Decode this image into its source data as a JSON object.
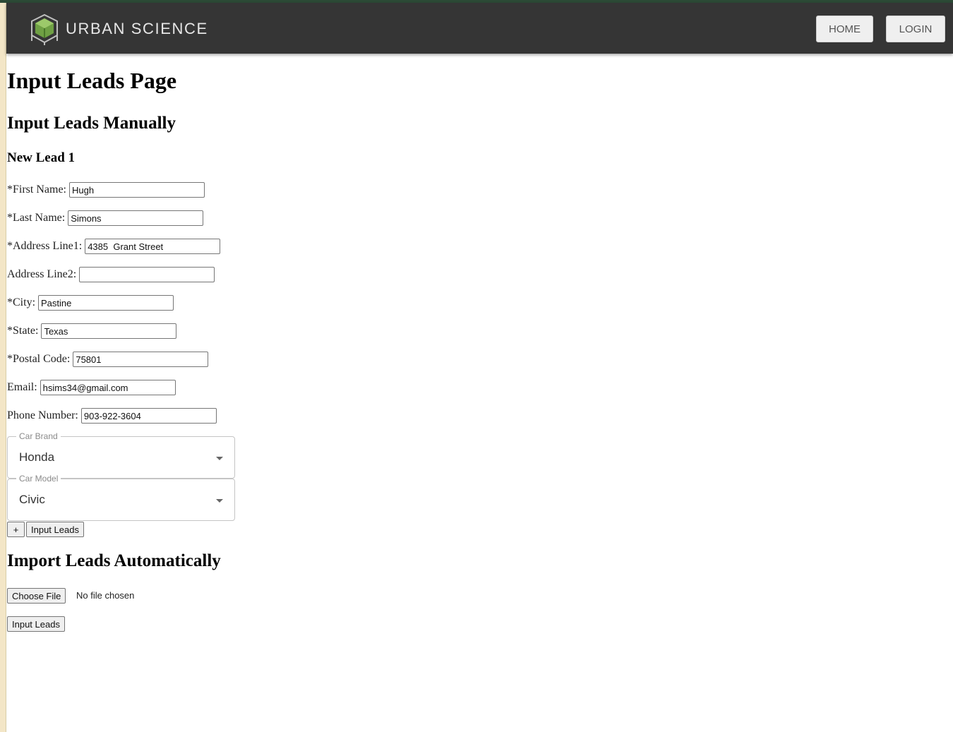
{
  "header": {
    "brand": "URBAN SCIENCE",
    "nav": {
      "home": "HOME",
      "login": "LOGIN"
    }
  },
  "page": {
    "title": "Input Leads Page",
    "manual_section_title": "Input Leads Manually",
    "lead_title": "New Lead 1",
    "auto_section_title": "Import Leads Automatically"
  },
  "form": {
    "first_name": {
      "label": "*First Name:",
      "value": "Hugh"
    },
    "last_name": {
      "label": "*Last Name:",
      "value": "Simons"
    },
    "address1": {
      "label": "*Address Line1:",
      "value": "4385  Grant Street"
    },
    "address2": {
      "label": "Address Line2:",
      "value": ""
    },
    "city": {
      "label": "*City:",
      "value": "Pastine"
    },
    "state": {
      "label": "*State:",
      "value": "Texas"
    },
    "postal": {
      "label": "*Postal Code:",
      "value": "75801"
    },
    "email": {
      "label": "Email:",
      "value": "hsims34@gmail.com"
    },
    "phone": {
      "label": "Phone Number:",
      "value": "903-922-3604"
    },
    "car_brand": {
      "label": "Car Brand",
      "value": "Honda"
    },
    "car_model": {
      "label": "Car Model",
      "value": "Civic"
    },
    "add_label": "+",
    "submit_label": "Input Leads"
  },
  "import": {
    "choose_file_label": "Choose File",
    "file_status": "No file chosen",
    "submit_label": "Input Leads"
  },
  "colors": {
    "appbar": "#353535",
    "frame": "#2c4a36"
  }
}
